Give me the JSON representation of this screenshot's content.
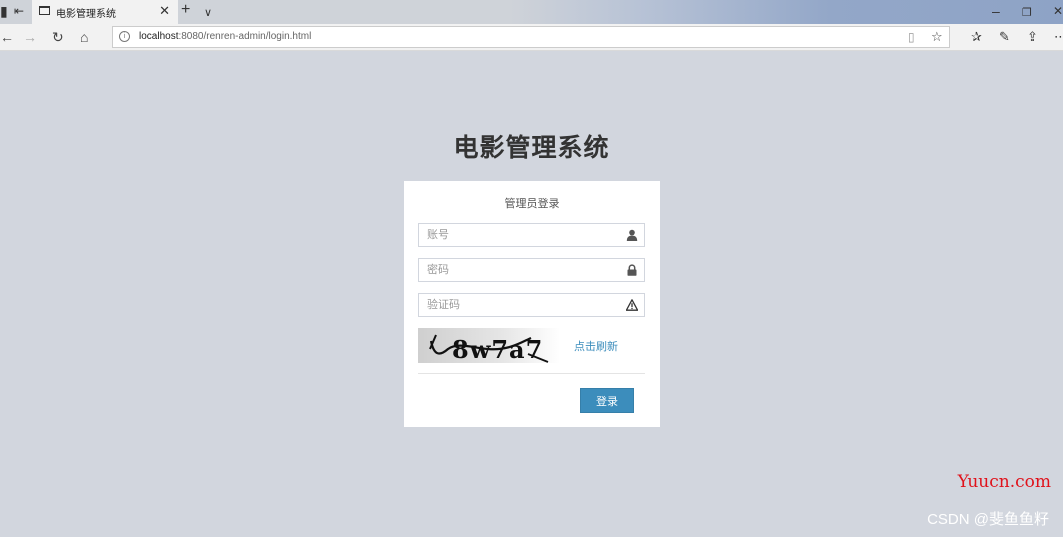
{
  "browser": {
    "tab_title": "电影管理系统",
    "url_host": "localhost",
    "url_rest": ":8080/renren-admin/login.html",
    "window_buttons": [
      "–",
      "❐",
      "✕"
    ]
  },
  "page": {
    "title": "电影管理系统"
  },
  "login": {
    "box_title": "管理员登录",
    "username_placeholder": "账号",
    "password_placeholder": "密码",
    "captcha_placeholder": "验证码",
    "captcha_text": "8w7a7",
    "refresh_label": "点击刷新",
    "submit_label": "登录"
  },
  "watermarks": {
    "site": "Yuucn.com",
    "csdn": "CSDN @斐鱼鱼籽"
  },
  "colors": {
    "page_background": "#d2d6de",
    "accent": "#3c8dbc",
    "watermark_red": "#e0121b"
  }
}
